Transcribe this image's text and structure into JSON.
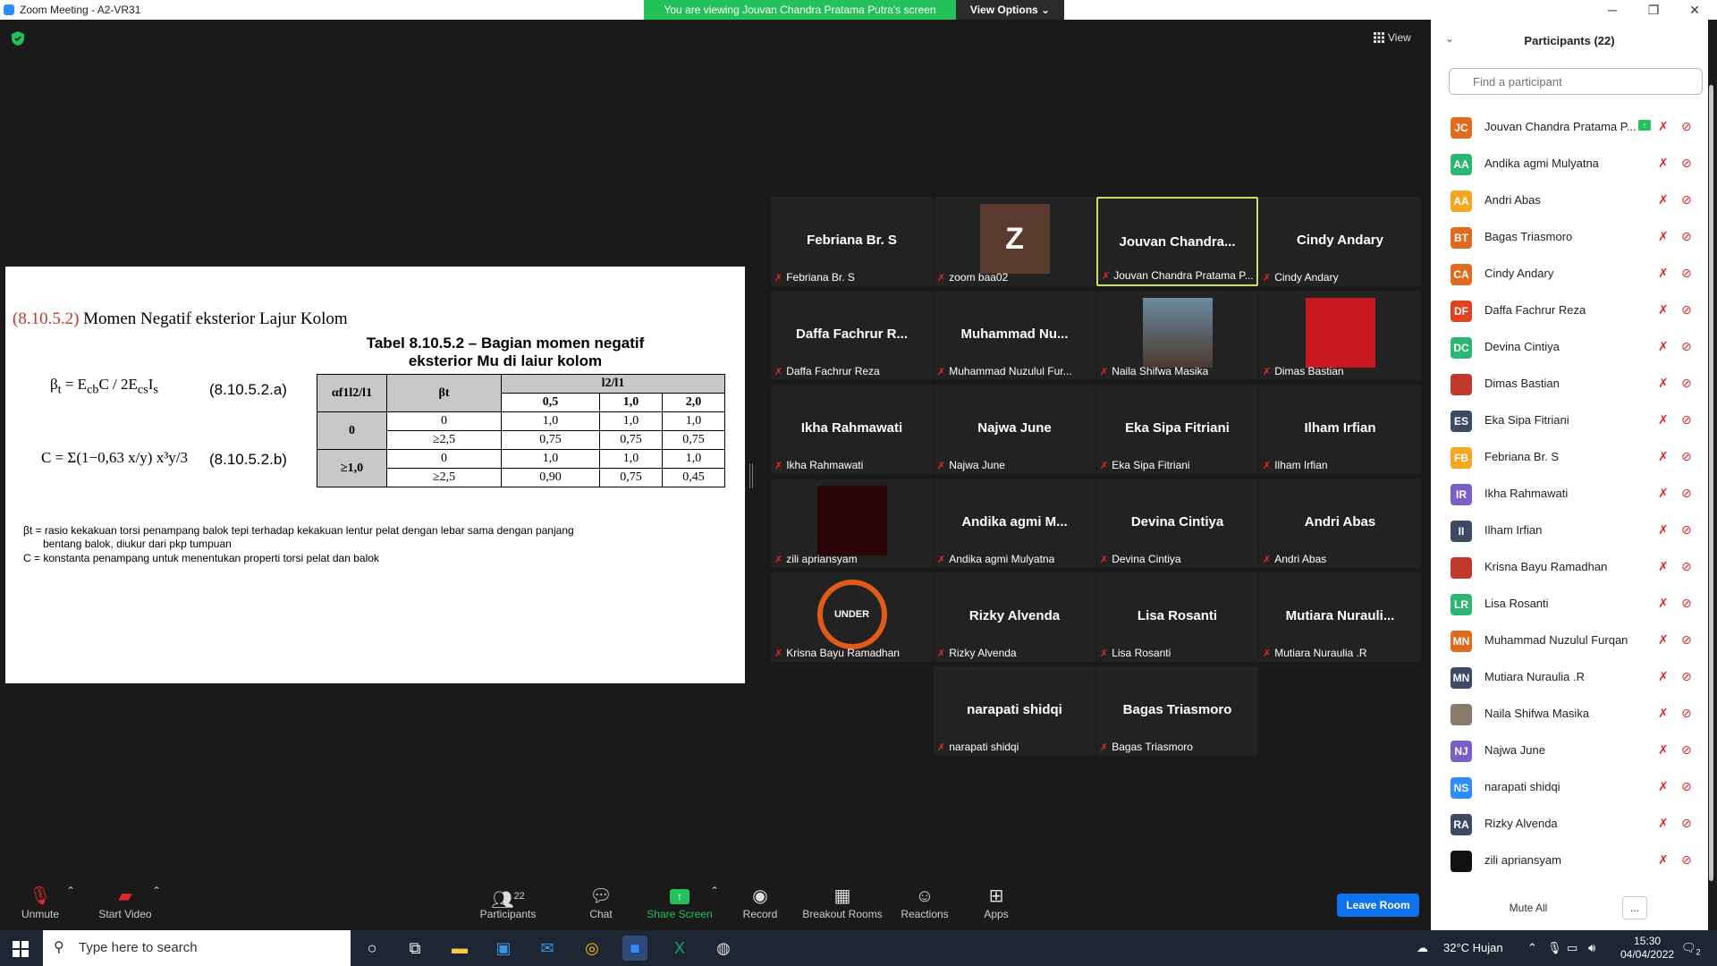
{
  "window": {
    "title": "Zoom Meeting - A2-VR31"
  },
  "banner": {
    "viewing": "You are viewing Jouvan Chandra Pratama Putra's screen",
    "view_options": "View Options"
  },
  "view_label": "View",
  "slide": {
    "section_num": "(8.10.5.2)",
    "section_title": "Momen Negatif eksterior Lajur Kolom",
    "table_title_line1": "Tabel 8.10.5.2 – Bagian momen negatif",
    "table_title_line2": "eksterior Mu di laiur kolom",
    "eq_a": "(8.10.5.2.a)",
    "eq_b": "(8.10.5.2.b)",
    "table": {
      "col1_header": "αf1l2/l1",
      "col2_header": "βt",
      "span_header": "l2/l1",
      "ratios": [
        "0,5",
        "1,0",
        "2,0"
      ],
      "rows": [
        {
          "group": "0",
          "beta": "0",
          "values": [
            "1,0",
            "1,0",
            "1,0"
          ]
        },
        {
          "group": "",
          "beta": "≥2,5",
          "values": [
            "0,75",
            "0,75",
            "0,75"
          ]
        },
        {
          "group": "≥1,0",
          "beta": "0",
          "values": [
            "1,0",
            "1,0",
            "1,0"
          ]
        },
        {
          "group": "",
          "beta": "≥2,5",
          "values": [
            "0,90",
            "0,75",
            "0,45"
          ]
        }
      ]
    },
    "note1a": "βt = rasio kekakuan torsi penampang balok tepi terhadap kekakuan lentur pelat dengan lebar sama dengan panjang",
    "note1b": "bentang balok, diukur dari pkp tumpuan",
    "note2": "C = konstanta penampang untuk menentukan properti torsi pelat dan balok"
  },
  "gallery": [
    {
      "big": "Febriana Br. S",
      "label": "Febriana Br. S"
    },
    {
      "big": "Z",
      "label": "zoom baa02"
    },
    {
      "big": "Jouvan  Chandra...",
      "label": "Jouvan Chandra Pratama P..."
    },
    {
      "big": "Cindy Andary",
      "label": "Cindy Andary"
    },
    {
      "big": "Daffa Fachrur R...",
      "label": "Daffa Fachrur Reza"
    },
    {
      "big": "Muhammad  Nu...",
      "label": "Muhammad Nuzulul Fur..."
    },
    {
      "big": "",
      "label": "Naila Shifwa Masika"
    },
    {
      "big": "",
      "label": "Dimas Bastian"
    },
    {
      "big": "Ikha Rahmawati",
      "label": "Ikha Rahmawati"
    },
    {
      "big": "Najwa June",
      "label": "Najwa June"
    },
    {
      "big": "Eka Sipa Fitriani",
      "label": "Eka Sipa Fitriani"
    },
    {
      "big": "Ilham Irfian",
      "label": "Ilham Irfian"
    },
    {
      "big": "",
      "label": "zili apriansyam"
    },
    {
      "big": "Andika  agmi  M...",
      "label": "Andika agmi Mulyatna"
    },
    {
      "big": "Devina Cintiya",
      "label": "Devina Cintiya"
    },
    {
      "big": "Andri Abas",
      "label": "Andri Abas"
    },
    {
      "big": "UNDER",
      "label": "Krisna Bayu Ramadhan"
    },
    {
      "big": "Rizky Alvenda",
      "label": "Rizky Alvenda"
    },
    {
      "big": "Lisa Rosanti",
      "label": "Lisa Rosanti"
    },
    {
      "big": "Mutiara  Nurauli...",
      "label": "Mutiara Nuraulia .R"
    },
    {
      "big": "narapati shidqi",
      "label": "narapati shidqi"
    },
    {
      "big": "Bagas Triasmoro",
      "label": "Bagas Triasmoro"
    }
  ],
  "panel": {
    "title": "Participants (22)",
    "search_placeholder": "Find a participant",
    "participants": [
      {
        "initials": "JC",
        "name": "Jouvan Chandra Pratama P...",
        "color": "#e06b1f"
      },
      {
        "initials": "AA",
        "name": "Andika agmi Mulyatna",
        "color": "#2bb673"
      },
      {
        "initials": "AA",
        "name": "Andri Abas",
        "color": "#f5a623"
      },
      {
        "initials": "BT",
        "name": "Bagas Triasmoro",
        "color": "#e06b1f"
      },
      {
        "initials": "CA",
        "name": "Cindy Andary",
        "color": "#e06b1f"
      },
      {
        "initials": "DF",
        "name": "Daffa Fachrur Reza",
        "color": "#e0441f"
      },
      {
        "initials": "DC",
        "name": "Devina Cintiya",
        "color": "#2bb673"
      },
      {
        "initials": "",
        "name": "Dimas Bastian",
        "color": "#c0392b"
      },
      {
        "initials": "ES",
        "name": "Eka Sipa Fitriani",
        "color": "#3d4a66"
      },
      {
        "initials": "FB",
        "name": "Febriana Br. S",
        "color": "#f5a623"
      },
      {
        "initials": "IR",
        "name": "Ikha Rahmawati",
        "color": "#7b5fc4"
      },
      {
        "initials": "II",
        "name": "Ilham Irfian",
        "color": "#3d4a66"
      },
      {
        "initials": "",
        "name": "Krisna Bayu Ramadhan",
        "color": "#c0392b"
      },
      {
        "initials": "LR",
        "name": "Lisa Rosanti",
        "color": "#2bb673"
      },
      {
        "initials": "MN",
        "name": "Muhammad Nuzulul Furqan",
        "color": "#e06b1f"
      },
      {
        "initials": "MN",
        "name": "Mutiara Nuraulia .R",
        "color": "#3d4a66"
      },
      {
        "initials": "",
        "name": "Naila Shifwa Masika",
        "color": "#8a7a6a"
      },
      {
        "initials": "NJ",
        "name": "Najwa June",
        "color": "#7b5fc4"
      },
      {
        "initials": "NS",
        "name": "narapati shidqi",
        "color": "#2d8cff"
      },
      {
        "initials": "RA",
        "name": "Rizky Alvenda",
        "color": "#3d4a66"
      },
      {
        "initials": "",
        "name": "zili apriansyam",
        "color": "#111111"
      }
    ],
    "mute_all": "Mute All",
    "more": "..."
  },
  "toolbar": {
    "unmute": "Unmute",
    "start_video": "Start Video",
    "participants": "Participants",
    "participants_count": "22",
    "chat": "Chat",
    "share_screen": "Share Screen",
    "record": "Record",
    "breakout": "Breakout Rooms",
    "reactions": "Reactions",
    "apps": "Apps",
    "leave": "Leave Room"
  },
  "taskbar": {
    "search_placeholder": "Type here to search",
    "weather": "32°C  Hujan",
    "time": "15:30",
    "date": "04/04/2022",
    "notifications": "2"
  }
}
